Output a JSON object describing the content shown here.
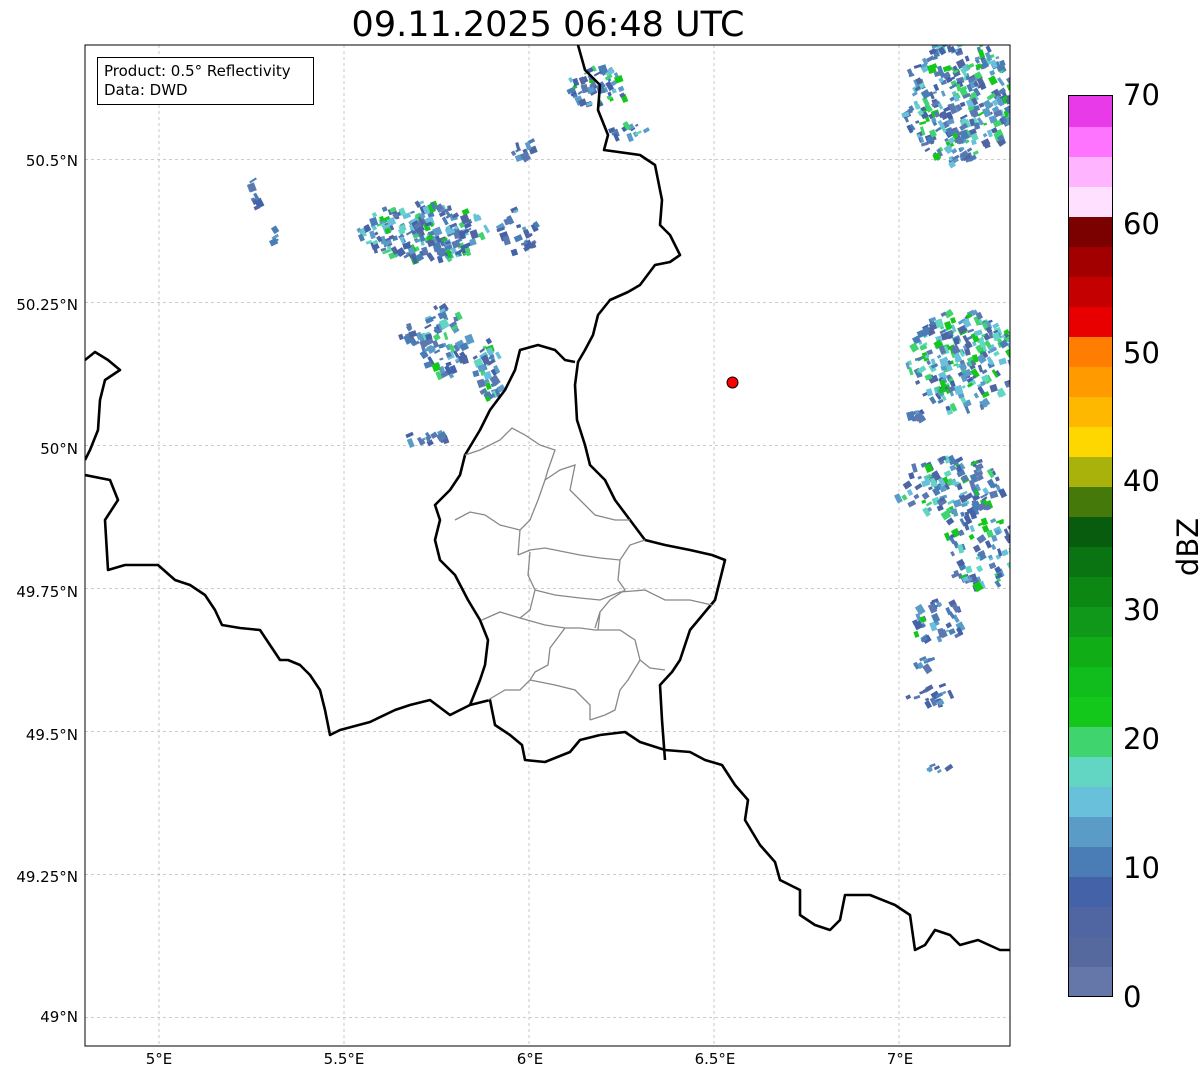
{
  "title": "09.11.2025 06:48 UTC",
  "info_box": {
    "product": "Product: 0.5° Reflectivity",
    "data": "Data: DWD"
  },
  "axes": {
    "lon_range": [
      4.8,
      7.3
    ],
    "lat_range": [
      48.95,
      50.7
    ],
    "lon_ticks": [
      {
        "value": 5.0,
        "label": "5°E"
      },
      {
        "value": 5.5,
        "label": "5.5°E"
      },
      {
        "value": 6.0,
        "label": "6°E"
      },
      {
        "value": 6.5,
        "label": "6.5°E"
      },
      {
        "value": 7.0,
        "label": "7°E"
      }
    ],
    "lat_ticks": [
      {
        "value": 50.5,
        "label": "50.5°N"
      },
      {
        "value": 50.25,
        "label": "50.25°N"
      },
      {
        "value": 50.0,
        "label": "50°N"
      },
      {
        "value": 49.75,
        "label": "49.75°N"
      },
      {
        "value": 49.5,
        "label": "49.5°N"
      },
      {
        "value": 49.25,
        "label": "49.25°N"
      },
      {
        "value": 49.0,
        "label": "49°N"
      }
    ],
    "grid": true
  },
  "marker": {
    "lon": 6.55,
    "lat": 50.11,
    "color": "#ff0000"
  },
  "colorbar": {
    "unit_label": "dBZ",
    "range": [
      0,
      70
    ],
    "tick_labels": [
      "0",
      "10",
      "20",
      "30",
      "40",
      "50",
      "60",
      "70"
    ],
    "colors": [
      "#6577a8",
      "#56699f",
      "#4f66a2",
      "#4462a8",
      "#4a7db6",
      "#5b9bc8",
      "#68c0da",
      "#63d6c3",
      "#3fd46e",
      "#14c81b",
      "#10bd1c",
      "#11ad17",
      "#0f981a",
      "#0c8713",
      "#0a7312",
      "#075c0e",
      "#457a0b",
      "#a9b20a",
      "#ffd700",
      "#ffb800",
      "#ff9a00",
      "#ff7d00",
      "#e80000",
      "#c40000",
      "#a20000",
      "#7b0000",
      "#ffe0ff",
      "#ffb4ff",
      "#ff74ff",
      "#e93ae9"
    ]
  }
}
